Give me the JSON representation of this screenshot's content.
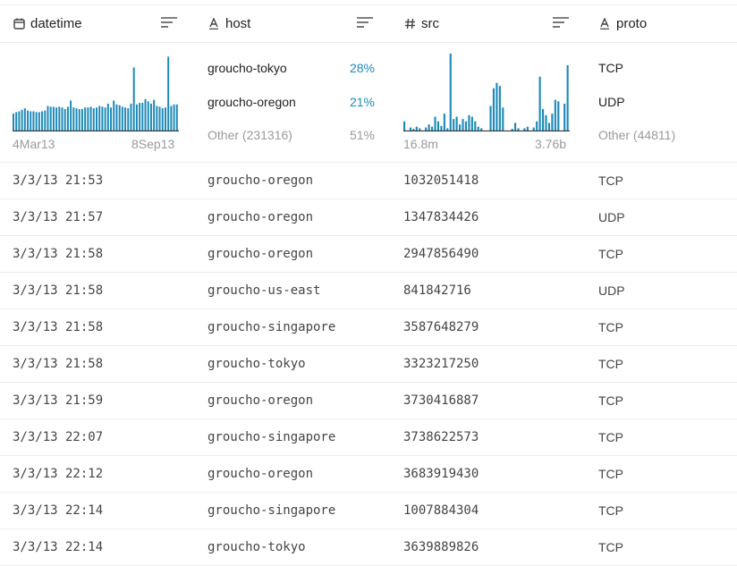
{
  "columns": [
    {
      "label": "datetime",
      "icon": "calendar-icon"
    },
    {
      "label": "host",
      "icon": "text-type-icon"
    },
    {
      "label": "src",
      "icon": "hash-icon"
    },
    {
      "label": "proto",
      "icon": "text-type-icon"
    }
  ],
  "summary": {
    "datetime": {
      "min_label": "4Mar13",
      "max_label": "8Sep13",
      "histogram": [
        0.22,
        0.24,
        0.25,
        0.27,
        0.29,
        0.26,
        0.25,
        0.25,
        0.24,
        0.24,
        0.25,
        0.26,
        0.32,
        0.31,
        0.31,
        0.3,
        0.31,
        0.3,
        0.28,
        0.31,
        0.39,
        0.3,
        0.29,
        0.28,
        0.28,
        0.3,
        0.3,
        0.31,
        0.29,
        0.3,
        0.32,
        0.31,
        0.3,
        0.35,
        0.3,
        0.39,
        0.34,
        0.33,
        0.31,
        0.3,
        0.29,
        0.35,
        0.82,
        0.34,
        0.36,
        0.36,
        0.41,
        0.38,
        0.35,
        0.4,
        0.32,
        0.31,
        0.29,
        0.3,
        0.96,
        0.32,
        0.34,
        0.34
      ]
    },
    "host": {
      "categories": [
        {
          "name": "groucho-tokyo",
          "pct": "28%"
        },
        {
          "name": "groucho-oregon",
          "pct": "21%"
        }
      ],
      "other": {
        "name": "Other (231316)",
        "pct": "51%"
      }
    },
    "src": {
      "min_label": "16.8m",
      "max_label": "3.76b",
      "histogram": [
        0.12,
        0,
        0.04,
        0.02,
        0.05,
        0.03,
        0,
        0.04,
        0.08,
        0.05,
        0.18,
        0.12,
        0.06,
        0.22,
        0.03,
        1.0,
        0.15,
        0.18,
        0.08,
        0.15,
        0.12,
        0.2,
        0.18,
        0.12,
        0.05,
        0.03,
        0,
        0,
        0.32,
        0.55,
        0.62,
        0.58,
        0.3,
        0,
        0,
        0.02,
        0.1,
        0.03,
        0,
        0.03,
        0.05,
        0,
        0.04,
        0.12,
        0.7,
        0.28,
        0.2,
        0.1,
        0.22,
        0.4,
        0.38,
        0,
        0.35,
        0.85
      ]
    },
    "proto": {
      "categories": [
        {
          "name": "TCP"
        },
        {
          "name": "UDP"
        }
      ],
      "other": {
        "name": "Other (44811)"
      }
    }
  },
  "rows": [
    {
      "datetime": "3/3/13 21:53",
      "host": "groucho-oregon",
      "src": "1032051418",
      "proto": "TCP"
    },
    {
      "datetime": "3/3/13 21:57",
      "host": "groucho-oregon",
      "src": "1347834426",
      "proto": "UDP"
    },
    {
      "datetime": "3/3/13 21:58",
      "host": "groucho-oregon",
      "src": "2947856490",
      "proto": "TCP"
    },
    {
      "datetime": "3/3/13 21:58",
      "host": "groucho-us-east",
      "src": "841842716",
      "proto": "UDP"
    },
    {
      "datetime": "3/3/13 21:58",
      "host": "groucho-singapore",
      "src": "3587648279",
      "proto": "TCP"
    },
    {
      "datetime": "3/3/13 21:58",
      "host": "groucho-tokyo",
      "src": "3323217250",
      "proto": "TCP"
    },
    {
      "datetime": "3/3/13 21:59",
      "host": "groucho-oregon",
      "src": "3730416887",
      "proto": "TCP"
    },
    {
      "datetime": "3/3/13 22:07",
      "host": "groucho-singapore",
      "src": "3738622573",
      "proto": "TCP"
    },
    {
      "datetime": "3/3/13 22:12",
      "host": "groucho-oregon",
      "src": "3683919430",
      "proto": "TCP"
    },
    {
      "datetime": "3/3/13 22:14",
      "host": "groucho-singapore",
      "src": "1007884304",
      "proto": "TCP"
    },
    {
      "datetime": "3/3/13 22:14",
      "host": "groucho-tokyo",
      "src": "3639889826",
      "proto": "TCP"
    }
  ],
  "colors": {
    "bar": "#1d8ab8",
    "border": "#ececec",
    "muted": "#9a9a9a"
  }
}
